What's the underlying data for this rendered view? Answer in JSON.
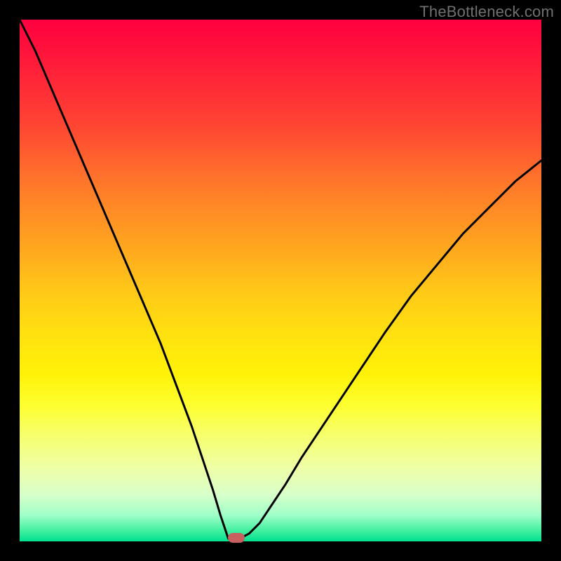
{
  "watermark": "TheBottleneck.com",
  "chart_data": {
    "type": "line",
    "title": "",
    "xlabel": "",
    "ylabel": "",
    "xlim": [
      0,
      100
    ],
    "ylim": [
      0,
      100
    ],
    "grid": false,
    "legend": false,
    "x": [
      0,
      3,
      6,
      9,
      12,
      15,
      18,
      21,
      24,
      27,
      30,
      33,
      35,
      37,
      38.5,
      39.5,
      40,
      41,
      42.5,
      44,
      46,
      48,
      51,
      54,
      58,
      62,
      66,
      70,
      75,
      80,
      85,
      90,
      95,
      100
    ],
    "y": [
      100,
      94,
      87,
      80,
      73,
      66,
      59,
      52,
      45,
      38,
      30,
      22,
      16,
      10,
      5,
      2,
      0.5,
      0.5,
      0.7,
      1.5,
      3.5,
      6.5,
      11,
      16,
      22,
      28,
      34,
      40,
      47,
      53,
      59,
      64,
      69,
      73
    ],
    "marker": {
      "x": 41.5,
      "y": 0.7
    },
    "gradient_stops": [
      {
        "pos": 0.0,
        "color": "#ff0040"
      },
      {
        "pos": 0.5,
        "color": "#ffe010"
      },
      {
        "pos": 1.0,
        "color": "#00e090"
      }
    ]
  }
}
